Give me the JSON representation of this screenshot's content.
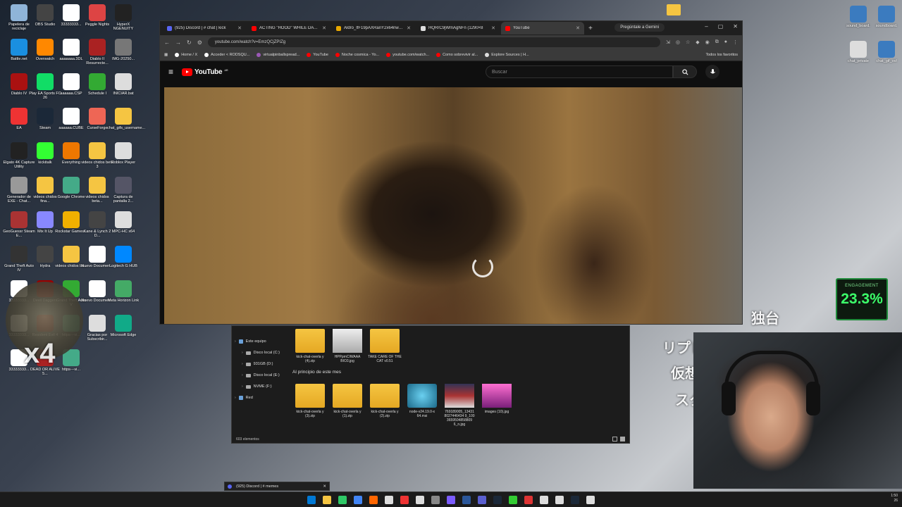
{
  "desktop": {
    "icons": [
      {
        "label": "Papelera de reciclaje",
        "color": "#8fb4d8"
      },
      {
        "label": "OBS Studio",
        "color": "#444"
      },
      {
        "label": "33333333...",
        "color": "#fff"
      },
      {
        "label": "Peggle Nights",
        "color": "#d44"
      },
      {
        "label": "HyperX NGENUITY",
        "color": "#222"
      },
      {
        "label": "Battle.net",
        "color": "#1a8fe0"
      },
      {
        "label": "Overwatch",
        "color": "#f80"
      },
      {
        "label": "aaaaaaa.3DL",
        "color": "#fff"
      },
      {
        "label": "Diablo II Resurrecte...",
        "color": "#a22"
      },
      {
        "label": "IMG-20250...",
        "color": "#777"
      },
      {
        "label": "Diablo IV",
        "color": "#a11"
      },
      {
        "label": "Play EA Sports FC 26",
        "color": "#1d6"
      },
      {
        "label": "aaaaaa.CSP",
        "color": "#fff"
      },
      {
        "label": "Schedule I",
        "color": "#3a3"
      },
      {
        "label": "INICIAR.bat",
        "color": "#ddd"
      },
      {
        "label": "EA",
        "color": "#e33"
      },
      {
        "label": "Steam",
        "color": "#1b2838"
      },
      {
        "label": "aaaaaa.CUBE",
        "color": "#fff"
      },
      {
        "label": "CurseForge",
        "color": "#e65"
      },
      {
        "label": "chat_gifs_username...",
        "color": "#f5c542"
      },
      {
        "label": "Elgato 4K Capture Utility",
        "color": "#222"
      },
      {
        "label": "kickitalk",
        "color": "#3f3"
      },
      {
        "label": "Everything",
        "color": "#e70"
      },
      {
        "label": "videos chidos beta 3",
        "color": "#f5c542"
      },
      {
        "label": "Roblox Player",
        "color": "#ddd"
      },
      {
        "label": "Generador de EXE - Chat...",
        "color": "#999"
      },
      {
        "label": "videos chidos fina...",
        "color": "#f5c542"
      },
      {
        "label": "Google Chrome",
        "color": "#4a8"
      },
      {
        "label": "videos chidos beta...",
        "color": "#f5c542"
      },
      {
        "label": "Captura de pantalla 2...",
        "color": "#556"
      },
      {
        "label": "GeoGuessr Steam E...",
        "color": "#a33"
      },
      {
        "label": "Mix It Up",
        "color": "#88f"
      },
      {
        "label": "Rockstar Games...",
        "color": "#f0b000"
      },
      {
        "label": "Kane & Lynch 2 D...",
        "color": "#444"
      },
      {
        "label": "MPC-HC x64",
        "color": "#ddd"
      },
      {
        "label": "Grand Theft Auto IV",
        "color": "#333"
      },
      {
        "label": "Hydra",
        "color": "#444"
      },
      {
        "label": "videos chidos be...",
        "color": "#f5c542"
      },
      {
        "label": "Nuevo Documen...",
        "color": "#fff"
      },
      {
        "label": "Logitech G HUB",
        "color": "#08f"
      },
      {
        "label": "33333333...",
        "color": "#fff"
      },
      {
        "label": "Devil Daggers",
        "color": "#900"
      },
      {
        "label": "Grand Theft Auto V",
        "color": "#3a3"
      },
      {
        "label": "Nuevo Documen...",
        "color": "#fff"
      },
      {
        "label": "Meta Horizon Link",
        "color": "#4a6"
      },
      {
        "label": "33333333...",
        "color": "#fff"
      },
      {
        "label": "Resident Evil 4",
        "color": "#700"
      },
      {
        "label": "https---vi...",
        "color": "#4a8"
      },
      {
        "label": "Gracias por Subscribir...",
        "color": "#ddd"
      },
      {
        "label": "Microsoft Edge",
        "color": "#1a8"
      },
      {
        "label": "33333333...",
        "color": "#fff"
      },
      {
        "label": "DEAD OR ALIVE 5...",
        "color": "#a22"
      },
      {
        "label": "https---vi...",
        "color": "#4a8"
      }
    ]
  },
  "browser": {
    "tabs": [
      {
        "label": "(925) Discord | # chat | kick",
        "color": "#5865f2",
        "active": false
      },
      {
        "label": "ACTING \"HOOD\" WHILE DATIN",
        "color": "#ff0000",
        "active": false
      },
      {
        "label": "Aldro_lfF19pAXRanY2x64nwdU",
        "color": "#e8a800",
        "active": false
      },
      {
        "label": "HQRrC9jWmAgNFn (1290×8",
        "color": "#ddd",
        "active": false
      },
      {
        "label": "YouTube",
        "color": "#ff0000",
        "active": true
      }
    ],
    "new_tab": "+",
    "gemini": "Pregúntale a Gemini",
    "url": "youtube.com/watch?v=EmzQCjZPIZg",
    "bookmarks": [
      {
        "label": "Home / X",
        "color": "#fff"
      },
      {
        "label": "Acceder < RODSQU...",
        "color": "#fff"
      },
      {
        "label": "virtualpinballspread...",
        "color": "#9b59b6"
      },
      {
        "label": "YouTube",
        "color": "#ff0000"
      },
      {
        "label": "Noche cosmica - Yo...",
        "color": "#ff0000"
      },
      {
        "label": "youtube.com/watch...",
        "color": "#ff0000"
      },
      {
        "label": "Como sobrevivir al...",
        "color": "#ff0000"
      },
      {
        "label": "Explore Sources | H...",
        "color": "#ddd"
      }
    ],
    "all_bookmarks": "Todos los favoritos"
  },
  "youtube": {
    "logo_text": "YouTube",
    "country": "AR",
    "search_placeholder": "Buscar"
  },
  "explorer": {
    "nav": [
      {
        "label": "Este equipo",
        "indent": false
      },
      {
        "label": "Disco local (C:)",
        "indent": true
      },
      {
        "label": "931GB (D:)",
        "indent": true
      },
      {
        "label": "Disco local (E:)",
        "indent": true
      },
      {
        "label": "NVME (F:)",
        "indent": true
      },
      {
        "label": "Red",
        "indent": false
      }
    ],
    "group_header": "Al principio de este mes",
    "files_top": [
      {
        "label": "kick-chat-overla y (4).zip",
        "kind": "zip"
      },
      {
        "label": "HPPpmCIWAAA BIO3.jpg",
        "kind": "img"
      },
      {
        "label": "TAKE CARE OF THE CAT v0.51",
        "kind": "folder"
      }
    ],
    "files_bottom": [
      {
        "label": "kick-chat-overla y (3).zip",
        "kind": "zip"
      },
      {
        "label": "kick-chat-overla y (1).zip",
        "kind": "zip"
      },
      {
        "label": "kick-chat-overla y (2).zip",
        "kind": "zip"
      },
      {
        "label": "node-v24.19.0-x 64.msi",
        "kind": "msi"
      },
      {
        "label": "769189005_13431 8027446434 9_100 3659504858809 6_n.jpg",
        "kind": "photo"
      },
      {
        "label": "images (10).jpg",
        "kind": "pink"
      }
    ],
    "status": "603 elementos"
  },
  "overlay": {
    "engagement_label": "ENGAGEMENT",
    "engagement_value": "23.3%",
    "x4": "x4",
    "jp_lines": [
      "リプレイバ",
      "仮想",
      "スタ"
    ],
    "jp_top": "独台"
  },
  "taskbar": {
    "discord_preview": "(925) Discord | # memes",
    "time": "1:50",
    "date": "26",
    "icons": [
      "#0078d4",
      "#f5c542",
      "#2ec866",
      "#4285f4",
      "#ff6600",
      "#ddd",
      "#e33",
      "#ddd",
      "#888",
      "#7b5cff",
      "#2b579a",
      "#5a5fcf",
      "#1b2838",
      "#3c3",
      "#d33",
      "#ddd",
      "#ddd",
      "#1b2838",
      "#ddd"
    ]
  }
}
